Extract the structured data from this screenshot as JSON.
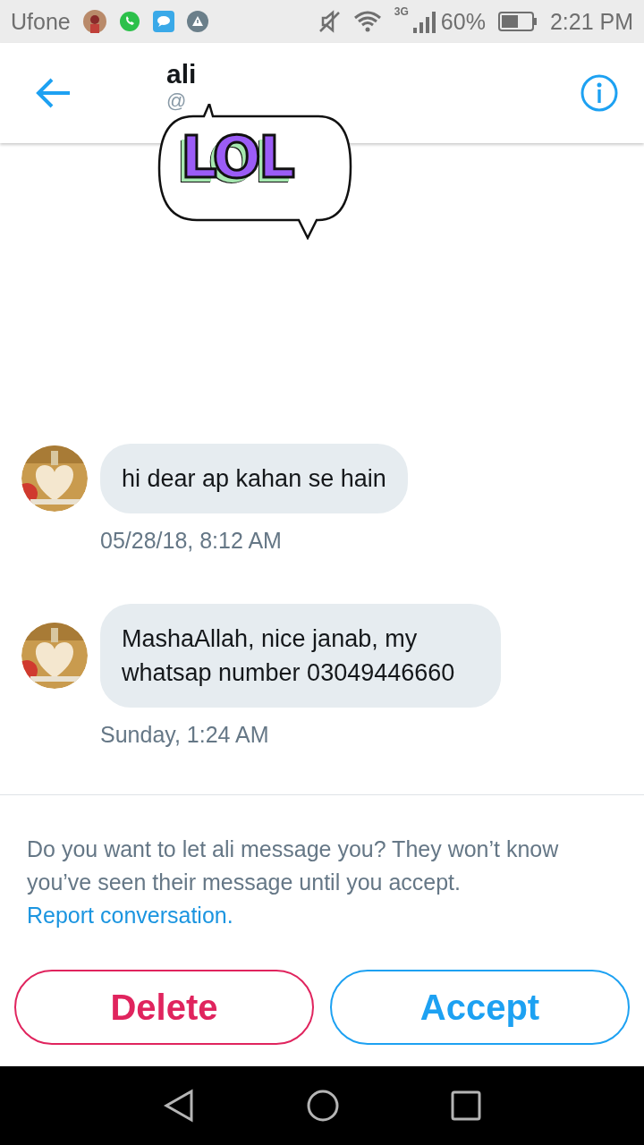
{
  "status_bar": {
    "carrier": "Ufone",
    "network": "3G",
    "battery": "60%",
    "time": "2:21 PM",
    "muted": true
  },
  "header": {
    "name": "ali",
    "handle": "@"
  },
  "sticker": {
    "text": "LOL"
  },
  "messages": [
    {
      "text": "hi dear ap kahan se hain",
      "timestamp": "05/28/18, 8:12 AM"
    },
    {
      "text": "MashaAllah, nice janab, my whatsap number 03049446660",
      "timestamp": "Sunday, 1:24 AM"
    }
  ],
  "request": {
    "prompt": "Do you want to let ali message you? They won’t know you’ve seen their message until you accept.",
    "link": "Report conversation.",
    "buttons": [
      {
        "label": "Delete",
        "kind": "destructive"
      },
      {
        "label": "Accept",
        "kind": "primary"
      }
    ]
  }
}
